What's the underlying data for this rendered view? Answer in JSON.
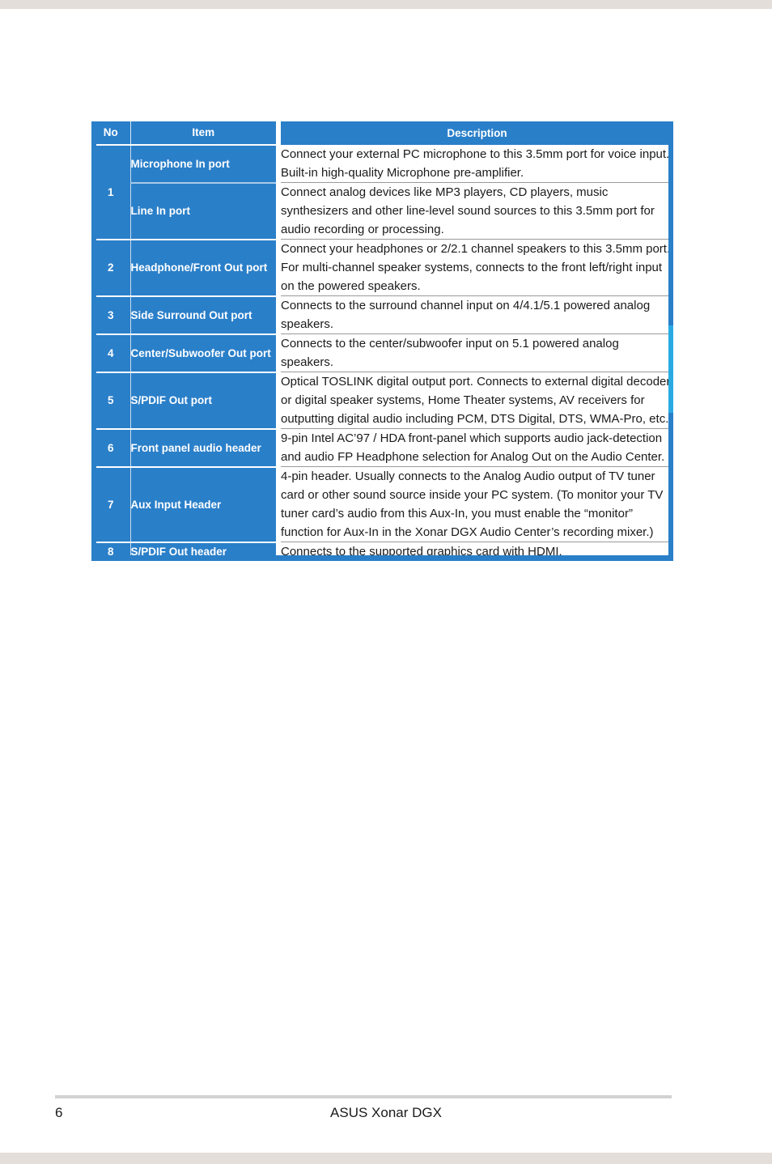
{
  "page": {
    "number": "6",
    "document_title": "ASUS Xonar DGX"
  },
  "table": {
    "columns": {
      "no": "No",
      "item": "Item",
      "description": "Description"
    },
    "accent_color": "#2a7fc9",
    "edge_tab_color": "#29abe2",
    "rows": [
      {
        "no": "1",
        "entries": [
          {
            "item": "Microphone In port",
            "description": "Connect your external PC microphone to this 3.5mm port for voice input. Built-in high-quality Microphone pre-amplifier."
          },
          {
            "item": "Line In port",
            "description": "Connect analog devices like MP3 players, CD players, music synthesizers and other line-level sound sources to this 3.5mm port for audio recording or processing."
          }
        ]
      },
      {
        "no": "2",
        "entries": [
          {
            "item": "Headphone/Front Out port",
            "description": "Connect your headphones or 2/2.1 channel speakers to this 3.5mm port. For multi-channel speaker systems, connects to the front left/right input on the powered speakers."
          }
        ]
      },
      {
        "no": "3",
        "entries": [
          {
            "item": "Side Surround Out port",
            "description": "Connects to the surround channel input on 4/4.1/5.1 powered analog speakers."
          }
        ]
      },
      {
        "no": "4",
        "entries": [
          {
            "item": "Center/Subwoofer Out port",
            "description": "Connects to the center/subwoofer input on 5.1 powered analog speakers."
          }
        ]
      },
      {
        "no": "5",
        "entries": [
          {
            "item": "S/PDIF Out port",
            "description": "Optical TOSLINK digital output port. Connects to external digital decoder or digital speaker systems, Home Theater systems, AV receivers for outputting digital audio including PCM, DTS Digital, DTS, WMA-Pro, etc."
          }
        ]
      },
      {
        "no": "6",
        "entries": [
          {
            "item": "Front panel audio header",
            "description": "9-pin Intel AC’97 / HDA front-panel which supports audio jack-detection and audio FP Headphone selection for Analog Out on the Audio Center."
          }
        ]
      },
      {
        "no": "7",
        "entries": [
          {
            "item": "Aux Input Header",
            "description": "4-pin header. Usually connects to the Analog Audio output of TV tuner card or other sound source inside your PC system. (To monitor your TV tuner card’s audio from this Aux-In, you must enable the “monitor” function for Aux-In in the Xonar DGX Audio Center’s recording mixer.)"
          }
        ]
      },
      {
        "no": "8",
        "entries": [
          {
            "item": "S/PDIF Out header",
            "description": "Connects to the supported graphics card with HDMI."
          }
        ]
      }
    ]
  }
}
